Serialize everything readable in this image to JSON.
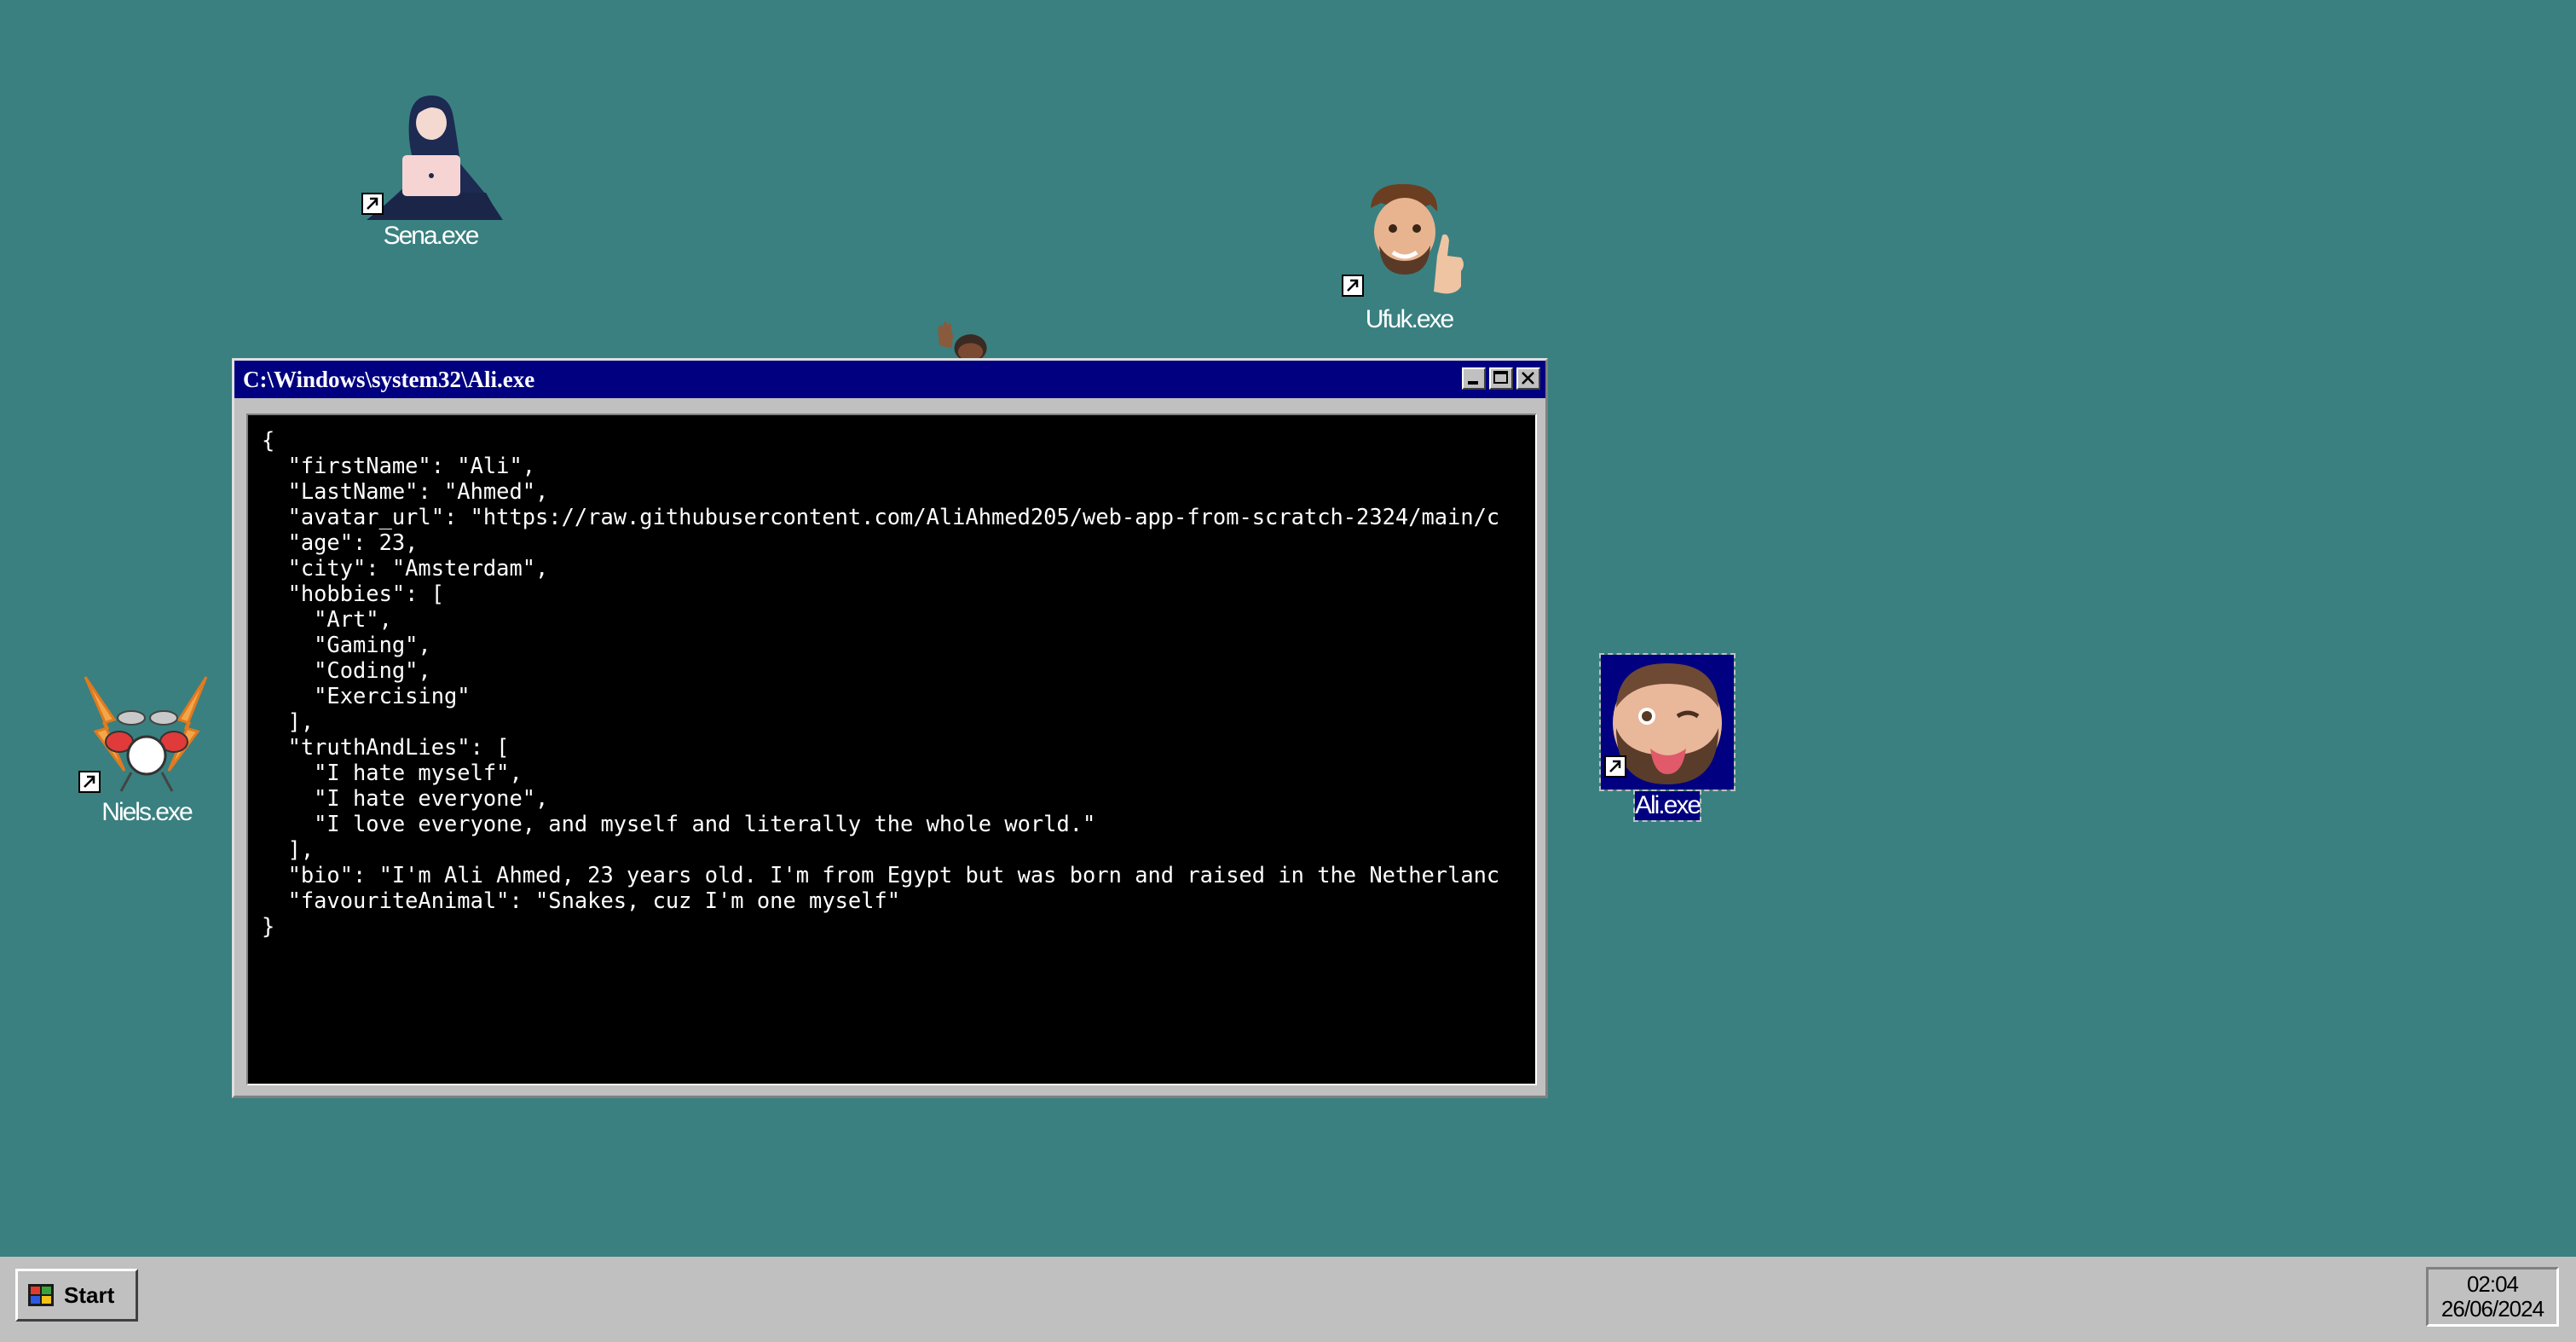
{
  "desktop": {
    "background": "#3a8080",
    "icons": [
      {
        "label": "Sena.exe",
        "icon": "woman-with-laptop-icon"
      },
      {
        "label": "Ufuk.exe",
        "icon": "thumbs-up-man-avatar-icon"
      },
      {
        "label": "Niels.exe",
        "icon": "drum-kit-lightning-icon"
      },
      {
        "label": "Ali.exe",
        "icon": "winking-bearded-man-avatar-icon",
        "selected": true
      },
      {
        "label": "",
        "icon": "waving-person-icon"
      }
    ]
  },
  "window": {
    "title": "C:\\Windows\\system32\\Ali.exe",
    "buttons": [
      "minimize",
      "maximize",
      "close"
    ],
    "console_lines": [
      "{",
      "  \"firstName\": \"Ali\",",
      "  \"LastName\": \"Ahmed\",",
      "  \"avatar_url\": \"https://raw.githubusercontent.com/AliAhmed205/web-app-from-scratch-2324/main/c",
      "  \"age\": 23,",
      "  \"city\": \"Amsterdam\",",
      "  \"hobbies\": [",
      "    \"Art\",",
      "    \"Gaming\",",
      "    \"Coding\",",
      "    \"Exercising\"",
      "  ],",
      "  \"truthAndLies\": [",
      "    \"I hate myself\",",
      "    \"I hate everyone\",",
      "    \"I love everyone, and myself and literally the whole world.\"",
      "  ],",
      "  \"bio\": \"I'm Ali Ahmed, 23 years old. I'm from Egypt but was born and raised in the Netherlanc",
      "  \"favouriteAnimal\": \"Snakes, cuz I'm one myself\"",
      "}"
    ]
  },
  "taskbar": {
    "start_label": "Start",
    "clock_time": "02:04",
    "clock_date": "26/06/2024"
  }
}
